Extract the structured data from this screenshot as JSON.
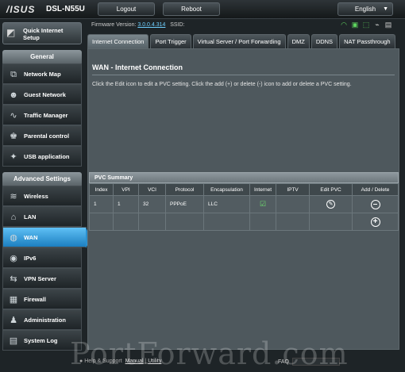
{
  "brand": "/ISUS",
  "model": "DSL-N55U",
  "top_buttons": {
    "logout": "Logout",
    "reboot": "Reboot"
  },
  "language": "English",
  "firmware": {
    "label": "Firmware Version:",
    "version": "3.0.0.4.314",
    "ssid_label": "SSID:"
  },
  "quick_setup": {
    "line1": "Quick Internet",
    "line2": "Setup"
  },
  "general": {
    "title": "General",
    "items": [
      {
        "label": "Network Map",
        "icon": "network-map-icon"
      },
      {
        "label": "Guest Network",
        "icon": "guest-network-icon"
      },
      {
        "label": "Traffic Manager",
        "icon": "traffic-manager-icon"
      },
      {
        "label": "Parental control",
        "icon": "parental-control-icon"
      },
      {
        "label": "USB application",
        "icon": "usb-application-icon"
      }
    ]
  },
  "advanced": {
    "title": "Advanced Settings",
    "items": [
      {
        "label": "Wireless",
        "icon": "wireless-icon"
      },
      {
        "label": "LAN",
        "icon": "lan-icon"
      },
      {
        "label": "WAN",
        "icon": "wan-icon",
        "active": true
      },
      {
        "label": "IPv6",
        "icon": "ipv6-icon"
      },
      {
        "label": "VPN Server",
        "icon": "vpn-server-icon"
      },
      {
        "label": "Firewall",
        "icon": "firewall-icon"
      },
      {
        "label": "Administration",
        "icon": "administration-icon"
      },
      {
        "label": "System Log",
        "icon": "system-log-icon"
      }
    ]
  },
  "tabs": [
    "Internet Connection",
    "Port Trigger",
    "Virtual Server / Port Forwarding",
    "DMZ",
    "DDNS",
    "NAT Passthrough"
  ],
  "page": {
    "title": "WAN - Internet Connection",
    "description": "Click the Edit icon to edit a PVC setting. Click the add (+) or delete (-) icon to add or delete a PVC setting."
  },
  "pvc": {
    "title": "PVC Summary",
    "columns": [
      "Index",
      "VPI",
      "VCI",
      "Protocol",
      "Encapsulation",
      "Internet",
      "IPTV",
      "Edit PVC",
      "Add / Delete"
    ],
    "row": {
      "index": "1",
      "vpi": "1",
      "vci": "32",
      "protocol": "PPPoE",
      "encapsulation": "LLC"
    }
  },
  "footer": {
    "help": "Help & Support",
    "manual": "Manual",
    "utility": "Utility",
    "faq": "FAQ"
  },
  "watermark": "PortForward.com",
  "colors": {
    "accent": "#2a90d0",
    "panel": "#4e585d",
    "ok": "#6ee06e"
  }
}
